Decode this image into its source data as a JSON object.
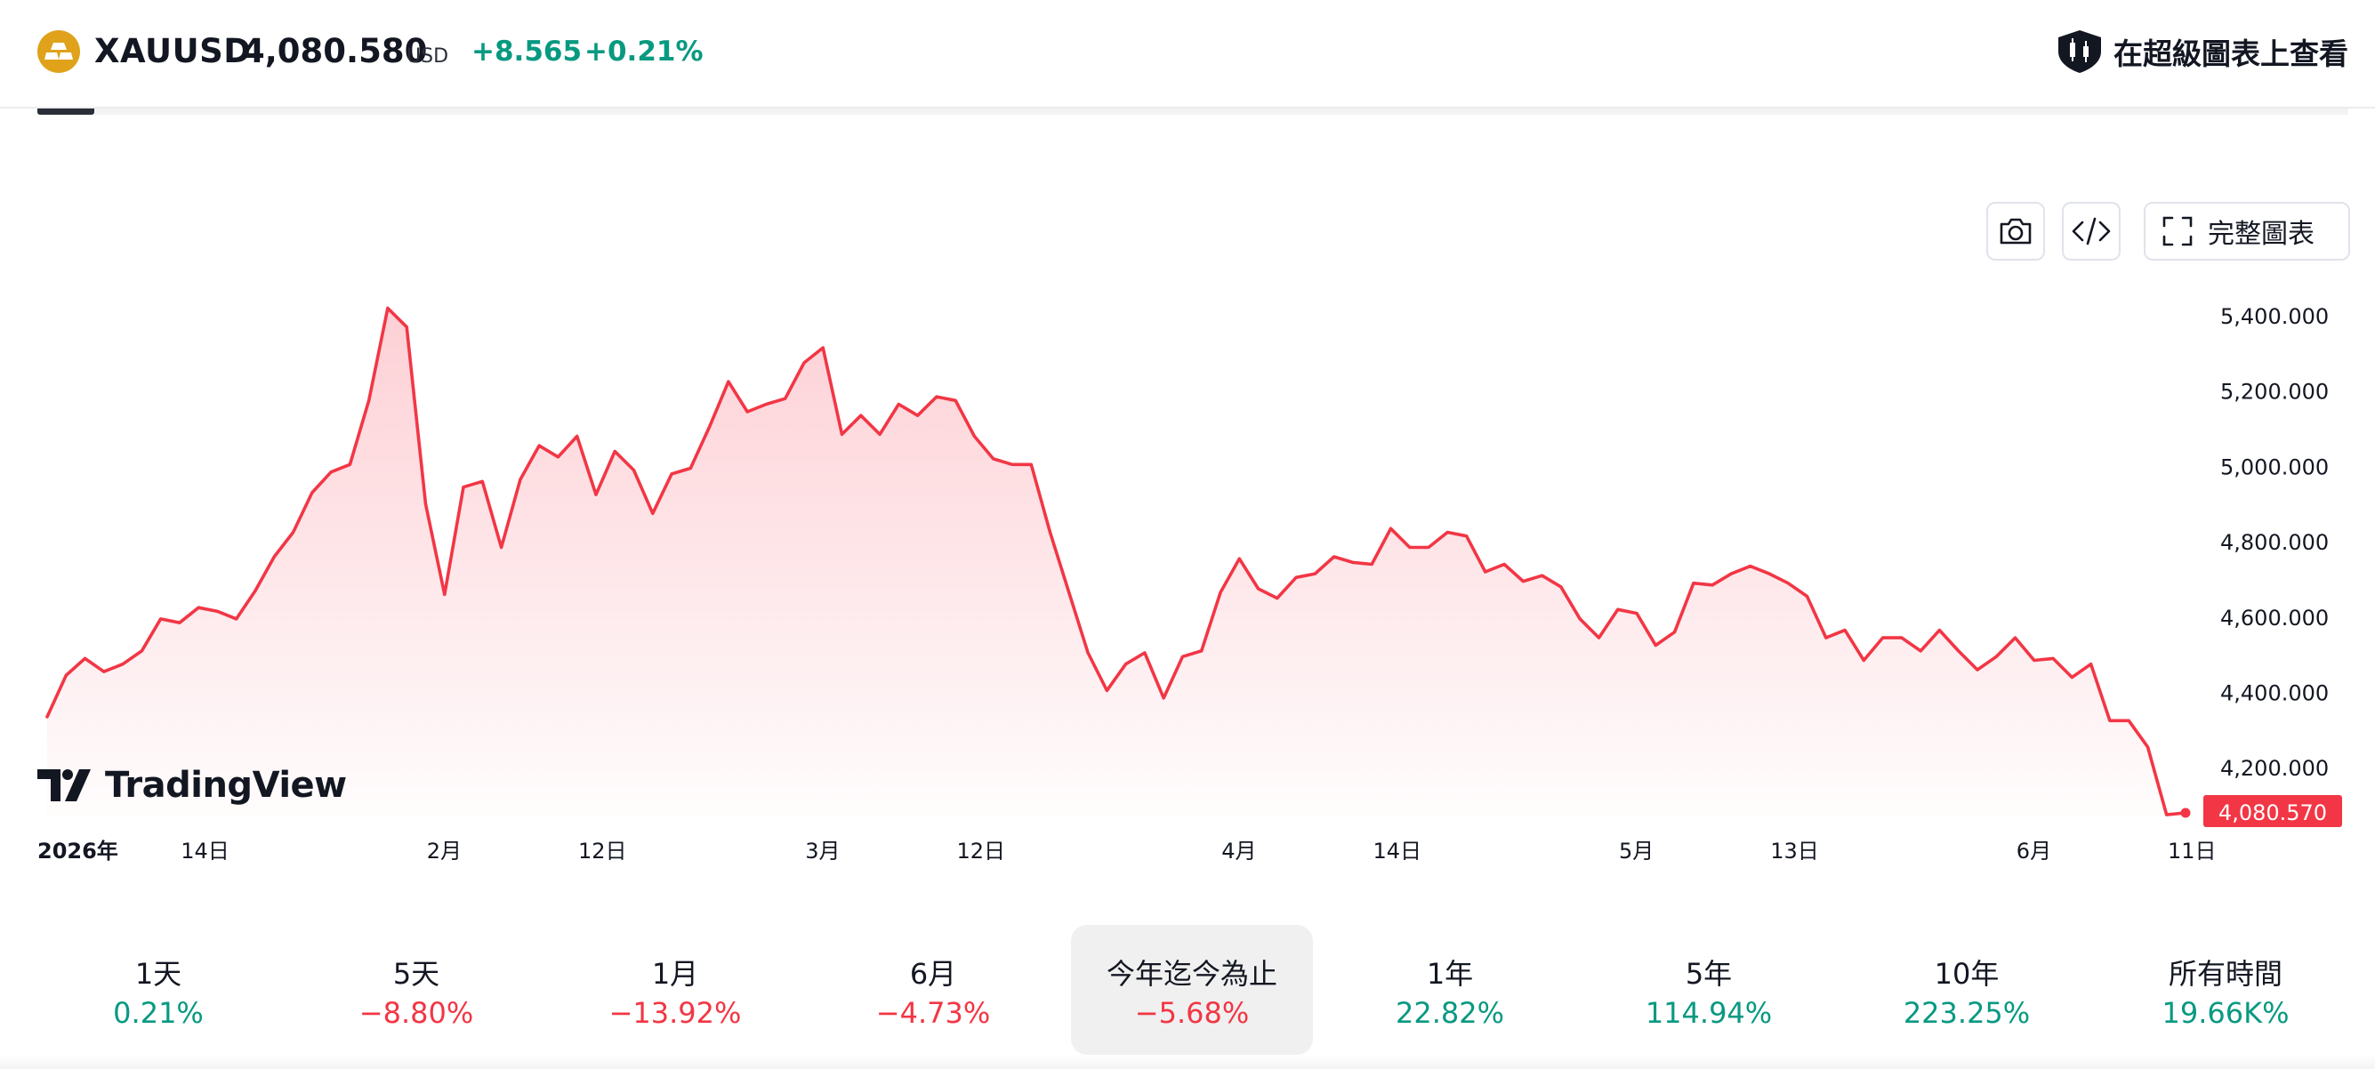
{
  "header": {
    "symbol": "XAUUSD",
    "price": "4,080.580",
    "currency": "USD",
    "change_abs": "+8.565",
    "change_pct": "+0.21%",
    "super_chart_label": "在超級圖表上查看"
  },
  "toolbar": {
    "snapshot_icon": "camera-icon",
    "embed_icon": "code-icon",
    "fullchart_icon": "fullscreen-icon",
    "fullchart_label": "完整圖表"
  },
  "watermark": {
    "text": "TradingView"
  },
  "colors": {
    "line": "#f23645",
    "positive": "#089981",
    "negative": "#f23645",
    "fill_top": "#fdd6da"
  },
  "chart_data": {
    "type": "area",
    "ylim": [
      4060,
      5470
    ],
    "y_ticks": [
      {
        "value": 5400,
        "label": "5,400.000"
      },
      {
        "value": 5200,
        "label": "5,200.000"
      },
      {
        "value": 5000,
        "label": "5,000.000"
      },
      {
        "value": 4800,
        "label": "4,800.000"
      },
      {
        "value": 4600,
        "label": "4,600.000"
      },
      {
        "value": 4400,
        "label": "4,400.000"
      },
      {
        "value": 4200,
        "label": "4,200.000"
      }
    ],
    "x_ticks": [
      {
        "index": 0,
        "label": "2026年",
        "bold": true
      },
      {
        "index": 8,
        "label": "14日"
      },
      {
        "index": 21,
        "label": "2月"
      },
      {
        "index": 29,
        "label": "12日"
      },
      {
        "index": 41,
        "label": "3月"
      },
      {
        "index": 49,
        "label": "12日"
      },
      {
        "index": 63,
        "label": "4月"
      },
      {
        "index": 71,
        "label": "14日"
      },
      {
        "index": 84,
        "label": "5月"
      },
      {
        "index": 92,
        "label": "13日"
      },
      {
        "index": 105,
        "label": "6月"
      },
      {
        "index": 113,
        "label": "11日"
      }
    ],
    "last_value_label": "4,080.570",
    "values": [
      4335,
      4445,
      4490,
      4455,
      4475,
      4510,
      4595,
      4585,
      4625,
      4615,
      4595,
      4670,
      4760,
      4825,
      4930,
      4985,
      5005,
      5175,
      5420,
      5370,
      4900,
      4660,
      4945,
      4960,
      4785,
      4965,
      5055,
      5025,
      5080,
      4925,
      5040,
      4990,
      4875,
      4980,
      4995,
      5105,
      5225,
      5145,
      5165,
      5180,
      5275,
      5315,
      5085,
      5135,
      5085,
      5165,
      5135,
      5185,
      5175,
      5080,
      5020,
      5005,
      5005,
      4825,
      4665,
      4505,
      4405,
      4475,
      4505,
      4385,
      4495,
      4510,
      4665,
      4755,
      4675,
      4650,
      4705,
      4715,
      4760,
      4745,
      4740,
      4835,
      4785,
      4785,
      4825,
      4815,
      4720,
      4740,
      4695,
      4710,
      4680,
      4595,
      4545,
      4620,
      4610,
      4525,
      4560,
      4690,
      4685,
      4715,
      4735,
      4715,
      4690,
      4655,
      4545,
      4565,
      4485,
      4545,
      4545,
      4510,
      4565,
      4510,
      4460,
      4495,
      4545,
      4485,
      4490,
      4440,
      4475,
      4325,
      4325,
      4255,
      4075,
      4080
    ]
  },
  "periods": [
    {
      "name": "1天",
      "value": "0.21%",
      "positive": true
    },
    {
      "name": "5天",
      "value": "−8.80%",
      "positive": false
    },
    {
      "name": "1月",
      "value": "−13.92%",
      "positive": false
    },
    {
      "name": "6月",
      "value": "−4.73%",
      "positive": false
    },
    {
      "name": "今年迄今為止",
      "value": "−5.68%",
      "positive": false,
      "active": true
    },
    {
      "name": "1年",
      "value": "22.82%",
      "positive": true
    },
    {
      "name": "5年",
      "value": "114.94%",
      "positive": true
    },
    {
      "name": "10年",
      "value": "223.25%",
      "positive": true
    },
    {
      "name": "所有時間",
      "value": "19.66K%",
      "positive": true
    }
  ]
}
